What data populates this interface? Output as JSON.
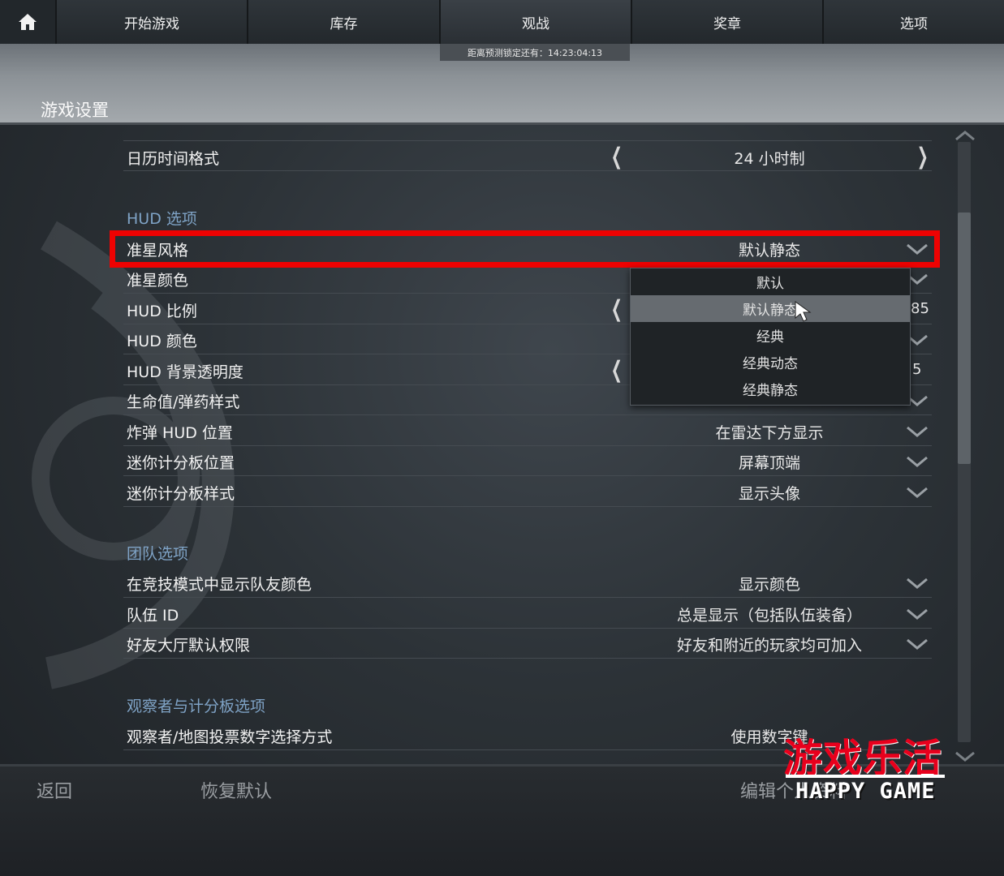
{
  "nav": {
    "home_icon": "home-icon",
    "tabs": [
      "开始游戏",
      "库存",
      "观战",
      "奖章",
      "选项"
    ],
    "countdown": "距离预测锁定还有：14:23:04:13"
  },
  "page": {
    "title": "游戏设置"
  },
  "rows": {
    "calendar": {
      "label": "日历时间格式",
      "value": "24 小时制"
    },
    "crosshair_style": {
      "label": "准星风格",
      "value": "默认静态"
    },
    "crosshair_color": {
      "label": "准星颜色"
    },
    "hud_scale": {
      "label": "HUD 比例",
      "partial_value": "85"
    },
    "hud_color": {
      "label": "HUD 颜色"
    },
    "hud_alpha": {
      "label": "HUD 背景透明度",
      "partial_value": "5"
    },
    "health_style": {
      "label": "生命值/弹药样式"
    },
    "bomb_hud": {
      "label": "炸弹 HUD 位置",
      "value": "在雷达下方显示"
    },
    "mini_pos": {
      "label": "迷你计分板位置",
      "value": "屏幕顶端"
    },
    "mini_style": {
      "label": "迷你计分板样式",
      "value": "显示头像"
    },
    "teammate_color": {
      "label": "在竞技模式中显示队友颜色",
      "value": "显示颜色"
    },
    "team_id": {
      "label": "队伍 ID",
      "value": "总是显示（包括队伍装备）"
    },
    "lobby": {
      "label": "好友大厅默认权限",
      "value": "好友和附近的玩家均可加入"
    },
    "spectator_vote": {
      "label": "观察者/地图投票数字选择方式",
      "value": "使用数字键"
    }
  },
  "sections": {
    "hud": "HUD 选项",
    "team": "团队选项",
    "spectator": "观察者与计分板选项"
  },
  "dropdown": {
    "options": [
      "默认",
      "默认静态",
      "经典",
      "经典动态",
      "经典静态"
    ],
    "selected": "默认静态"
  },
  "bottom": {
    "back": "返回",
    "restore": "恢复默认",
    "edit": "编辑个人资料"
  },
  "watermark": {
    "cn": "游戏乐活",
    "en": "HAPPY GAME"
  },
  "colors": {
    "accent_section": "#7fa3c6",
    "highlight": "#ee0202",
    "watermark_red": "#e8001c"
  }
}
